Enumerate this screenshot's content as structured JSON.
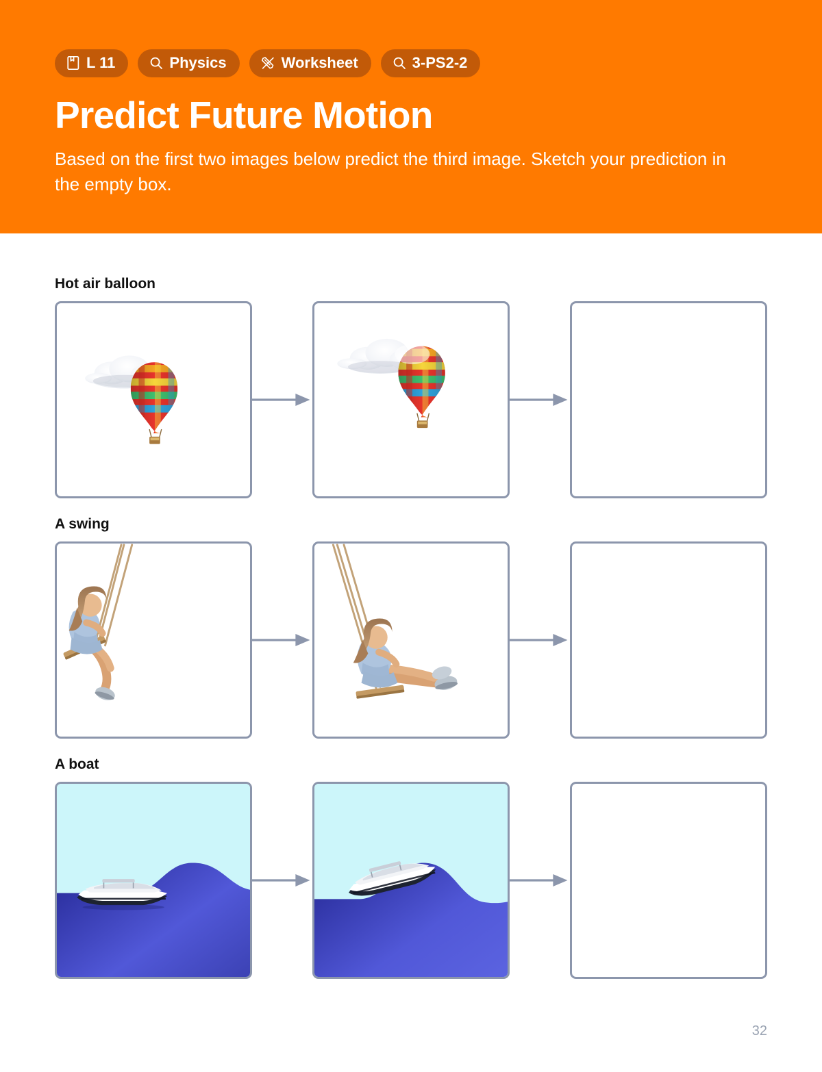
{
  "header": {
    "background_color": "#FF7A00",
    "badge_color": "#C25A08",
    "badges": [
      {
        "icon": "book-icon",
        "label": "L 11"
      },
      {
        "icon": "magnifier-icon",
        "label": "Physics"
      },
      {
        "icon": "pencil-ruler-icon",
        "label": "Worksheet"
      },
      {
        "icon": "magnifier-icon",
        "label": "3-PS2-2"
      }
    ],
    "title": "Predict Future Motion",
    "subtitle": "Based on the first two images below predict the third image. Sketch your prediction in the empty box."
  },
  "rows": [
    {
      "label": "Hot air balloon",
      "frames": [
        {
          "type": "balloon-low",
          "alt": "Cloud in upper area with rainbow hot air balloon below and to the right"
        },
        {
          "type": "balloon-high",
          "alt": "Rainbow hot air balloon risen to overlap the cloud"
        },
        {
          "type": "empty",
          "alt": "Empty sketch box"
        }
      ]
    },
    {
      "label": "A swing",
      "frames": [
        {
          "type": "swing-back",
          "alt": "Girl on a rope swing leaning back at the left of the frame"
        },
        {
          "type": "swing-forward",
          "alt": "Girl on a rope swing moved forward with legs extended"
        },
        {
          "type": "empty",
          "alt": "Empty sketch box"
        }
      ]
    },
    {
      "label": "A boat",
      "frames": [
        {
          "type": "boat-flat",
          "alt": "White speedboat on flat water with a wave crest at the right"
        },
        {
          "type": "boat-tilt",
          "alt": "White speedboat tilted riding up a wave that has moved left"
        },
        {
          "type": "empty",
          "alt": "Empty sketch box"
        }
      ]
    }
  ],
  "colors": {
    "frame_border": "#8C96AC",
    "arrow": "#8C96AC",
    "sky": "#CCF6FA",
    "wave_dark": "#2B2F9E",
    "wave_light": "#6B74E8",
    "page_number": "#9AA3B2"
  },
  "page_number": "32"
}
